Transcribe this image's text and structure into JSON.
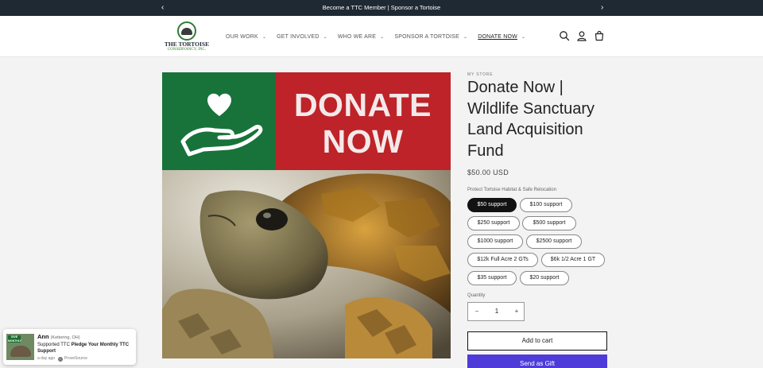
{
  "announcement": {
    "text": "Become a TTC Member | Sponsor a Tortoise",
    "prev_icon": "chevron-left-icon",
    "next_icon": "chevron-right-icon"
  },
  "logo": {
    "line1": "THE TORTOISE",
    "line2": "CONSERVANCY, INC."
  },
  "nav": {
    "items": [
      {
        "label": "OUR WORK",
        "active": false
      },
      {
        "label": "GET INVOLVED",
        "active": false
      },
      {
        "label": "WHO WE ARE",
        "active": false
      },
      {
        "label": "SPONSOR A TORTOISE",
        "active": false
      },
      {
        "label": "DONATE NOW",
        "active": true
      }
    ],
    "chevron": "⌄"
  },
  "header_icons": [
    "search-icon",
    "account-icon",
    "cart-icon"
  ],
  "media": {
    "banner_line1": "DONATE",
    "banner_line2": "NOW",
    "banner_green": "#17733a",
    "banner_red": "#bd2328"
  },
  "product": {
    "vendor": "MY STORE",
    "title": "Donate Now | Wildlife Sanctuary Land Acquisition Fund",
    "price": "$50.00 USD",
    "option_label": "Protect Tortoise Habitat & Safe Relocation",
    "options": [
      {
        "label": "$50 support",
        "selected": true
      },
      {
        "label": "$100 support",
        "selected": false
      },
      {
        "label": "$250 support",
        "selected": false
      },
      {
        "label": "$500 support",
        "selected": false
      },
      {
        "label": "$1000 support",
        "selected": false
      },
      {
        "label": "$2500 support",
        "selected": false
      },
      {
        "label": "$12k Full Acre 2 GTs",
        "selected": false
      },
      {
        "label": "$6k 1/2 Acre 1 GT",
        "selected": false
      },
      {
        "label": "$35 support",
        "selected": false
      },
      {
        "label": "$20 support",
        "selected": false
      }
    ],
    "quantity_label": "Quantity",
    "quantity": "1",
    "minus": "−",
    "plus": "+",
    "add_to_cart": "Add to cart",
    "send_as_gift": "Send as Gift"
  },
  "proof": {
    "name": "Ann",
    "location": "(Kettering, OH)",
    "message_prefix": "Supported TTC",
    "message_bold": "Pledge Your Monthly TTC Support",
    "time": "a day ago",
    "source": "ProveSource",
    "thumb_tag": "GIVE MONTHLY"
  },
  "colors": {
    "announcement_bg": "#1f2933",
    "accent_gift": "#4e3bd8",
    "selected_pill": "#121212"
  }
}
